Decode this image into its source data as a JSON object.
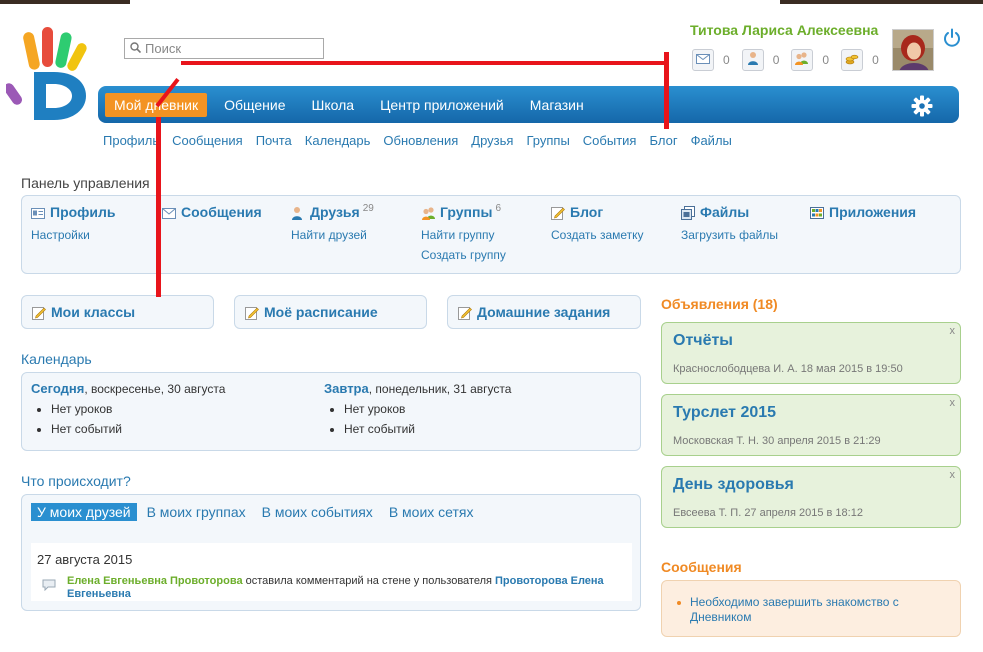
{
  "header": {
    "search_placeholder": "Поиск",
    "user_name": "Титова Лариса Алексеевна",
    "counters": [
      {
        "icon": "envelope-icon",
        "count": "0"
      },
      {
        "icon": "person-icon",
        "count": "0"
      },
      {
        "icon": "people-icon",
        "count": "0"
      },
      {
        "icon": "coins-icon",
        "count": "0"
      }
    ]
  },
  "nav": {
    "items": [
      "Мой дневник",
      "Общение",
      "Школа",
      "Центр приложений",
      "Магазин"
    ],
    "active_index": 0
  },
  "subnav": [
    "Профиль",
    "Сообщения",
    "Почта",
    "Календарь",
    "Обновления",
    "Друзья",
    "Группы",
    "События",
    "Блог",
    "Файлы"
  ],
  "control_panel": {
    "title": "Панель управления",
    "columns": [
      {
        "title": "Профиль",
        "icon": "profile-card-icon",
        "badge": "",
        "links": [
          "Настройки"
        ]
      },
      {
        "title": "Сообщения",
        "icon": "message-icon",
        "badge": "",
        "links": []
      },
      {
        "title": "Друзья",
        "icon": "person-icon",
        "badge": "29",
        "links": [
          "Найти друзей"
        ]
      },
      {
        "title": "Группы",
        "icon": "people-icon",
        "badge": "6",
        "links": [
          "Найти группу",
          "Создать группу"
        ]
      },
      {
        "title": "Блог",
        "icon": "pencil-icon",
        "badge": "",
        "links": [
          "Создать заметку"
        ]
      },
      {
        "title": "Файлы",
        "icon": "files-icon",
        "badge": "",
        "links": [
          "Загрузить файлы"
        ]
      },
      {
        "title": "Приложения",
        "icon": "apps-grid-icon",
        "badge": "",
        "links": []
      }
    ]
  },
  "quick_buttons": [
    "Мои классы",
    "Моё расписание",
    "Домашние задания"
  ],
  "calendar": {
    "title": "Календарь",
    "today_label": "Сегодня",
    "today_date": ", воскресенье, 30 августа",
    "today_items": [
      "Нет уроков",
      "Нет событий"
    ],
    "tomorrow_label": "Завтра",
    "tomorrow_date": ", понедельник, 31 августа",
    "tomorrow_items": [
      "Нет уроков",
      "Нет событий"
    ]
  },
  "whats_happening": {
    "title": "Что происходит?",
    "tabs": [
      "У моих друзей",
      "В моих группах",
      "В моих событиях",
      "В моих сетях"
    ],
    "active_tab": 0,
    "feed_date": "27 августа 2015",
    "feed_author": "Елена Евгеньевна Провоторова",
    "feed_action": " оставила комментарий на стене у пользователя ",
    "feed_target": "Провоторова Елена Евгеньевна"
  },
  "announcements": {
    "title": "Объявления (18)",
    "close_label": "x",
    "items": [
      {
        "title": "Отчёты",
        "meta": "Краснослободцева И. А. 18 мая 2015 в 19:50"
      },
      {
        "title": "Турслет 2015",
        "meta": "Московская Т. Н. 30 апреля 2015 в 21:29"
      },
      {
        "title": "День здоровья",
        "meta": "Евсеева Т. П. 27 апреля 2015 в 18:12"
      }
    ]
  },
  "messages": {
    "title": "Сообщения",
    "text": "Необходимо завершить знакомство с Дневником"
  },
  "colors": {
    "nav_blue": "#1f7fc1",
    "active_orange": "#f39323",
    "user_green": "#6cae2b",
    "annotation_red": "#e8141b"
  }
}
